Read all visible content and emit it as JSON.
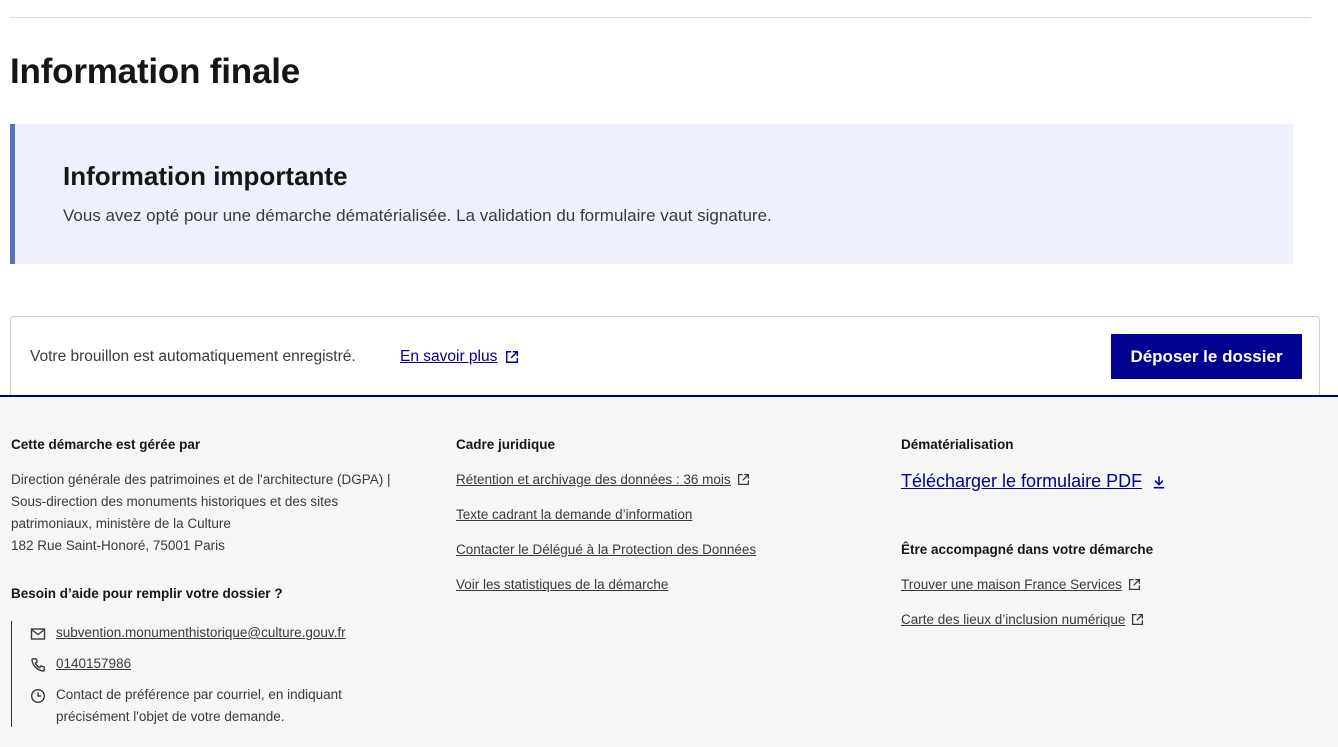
{
  "page": {
    "title": "Information finale"
  },
  "callout": {
    "title": "Information importante",
    "text": "Vous avez opté pour une démarche dématérialisée. La validation du formulaire vaut signature."
  },
  "submit_bar": {
    "draft_text": "Votre brouillon est automatiquement enregistré.",
    "learn_more_label": "En savoir plus",
    "deposit_label": "Déposer le dossier"
  },
  "footer": {
    "managed": {
      "heading": "Cette démarche est gérée par",
      "lines": [
        "Direction générale des patrimoines et de l'architecture (DGPA) |",
        "Sous-direction des monuments historiques et des sites",
        "patrimoniaux, ministère de la Culture",
        "182 Rue Saint-Honoré, 75001 Paris"
      ]
    },
    "help": {
      "heading": "Besoin d’aide pour remplir votre dossier ?",
      "email": "subvention.monumenthistorique@culture.gouv.fr",
      "phone": "0140157986",
      "note_line1": "Contact de préférence par courriel, en indiquant",
      "note_line2": "précisément l'objet de votre demande."
    },
    "legal": {
      "heading": "Cadre juridique",
      "links": [
        "Rétention et archivage des données : 36 mois",
        "Texte cadrant la demande d’information",
        "Contacter le Délégué à la Protection des Données",
        "Voir les statistiques de la démarche"
      ]
    },
    "dematerialisation": {
      "heading": "Dématérialisation",
      "pdf_label": "Télécharger le formulaire PDF"
    },
    "support": {
      "heading": "Être accompagné dans votre démarche",
      "links": [
        "Trouver une maison France Services",
        "Carte des lieux d’inclusion numérique"
      ]
    }
  },
  "colors": {
    "primary": "#000091",
    "callout_bg": "#eef1fd",
    "callout_border": "#5770be",
    "footer_bg": "#f6f6f6"
  },
  "icons": {
    "external": "external-link-icon",
    "download": "download-icon",
    "mail": "mail-icon",
    "phone": "phone-icon",
    "clock": "clock-icon"
  }
}
